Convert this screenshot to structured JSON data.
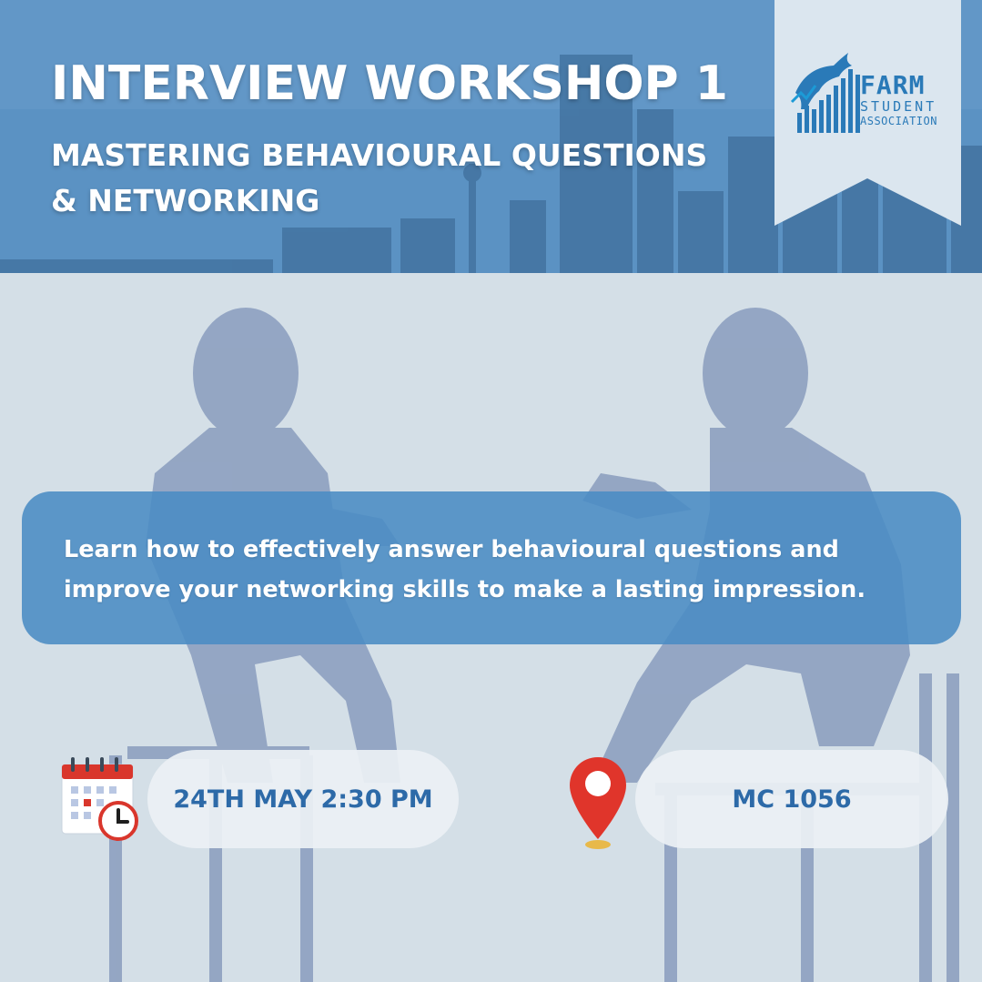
{
  "header": {
    "title": "INTERVIEW WORKSHOP 1",
    "subtitle_line1": "MASTERING BEHAVIOURAL QUESTIONS",
    "subtitle_line2": "& NETWORKING"
  },
  "logo": {
    "line1": "FARM",
    "line2": "STUDENT",
    "line3": "ASSOCIATION",
    "icon": "bull-chart-icon"
  },
  "description": "Learn how to effectively answer behavioural questions and improve your networking skills to make a lasting impression.",
  "event": {
    "date_time": "24TH MAY 2:30 PM",
    "location": "MC 1056",
    "date_icon": "calendar-clock-icon",
    "location_icon": "map-pin-icon"
  },
  "colors": {
    "header_blue": "#4f86b8",
    "accent_blue": "#2d6aa8",
    "pin_red": "#e0352b"
  }
}
